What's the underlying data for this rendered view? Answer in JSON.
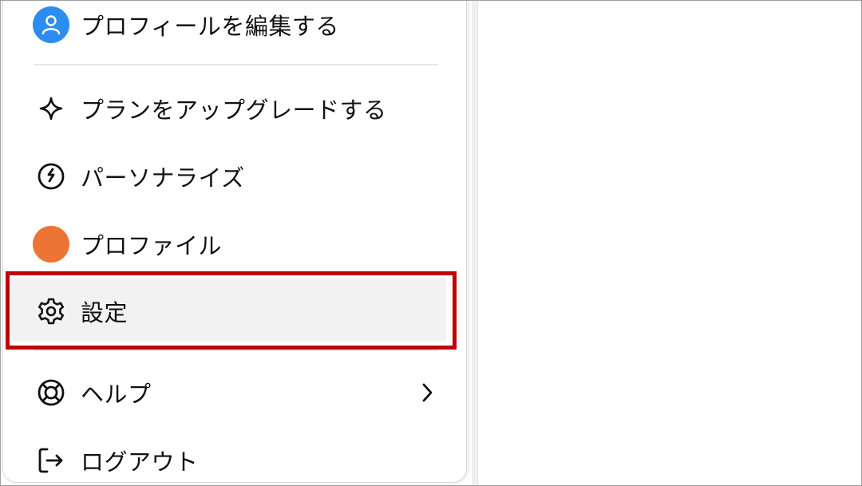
{
  "menu": {
    "items": [
      {
        "id": "edit-profile",
        "label": "プロフィールを編集する",
        "icon": "user-avatar-icon"
      },
      {
        "id": "upgrade-plan",
        "label": "プランをアップグレードする",
        "icon": "sparkle-icon"
      },
      {
        "id": "personalize",
        "label": "パーソナライズ",
        "icon": "personalize-icon"
      },
      {
        "id": "profile",
        "label": "プロファイル",
        "icon": "orange-avatar-icon"
      },
      {
        "id": "settings",
        "label": "設定",
        "icon": "gear-icon"
      },
      {
        "id": "help",
        "label": "ヘルプ",
        "icon": "lifebuoy-icon",
        "submenu_icon": "chevron-right-icon"
      },
      {
        "id": "logout",
        "label": "ログアウト",
        "icon": "logout-icon"
      }
    ]
  },
  "colors": {
    "highlight_border": "#c00000",
    "selected_bg": "#f2f2f2",
    "avatar_blue": "#2d8cf0",
    "avatar_orange": "#ec7434",
    "text": "#111111"
  }
}
